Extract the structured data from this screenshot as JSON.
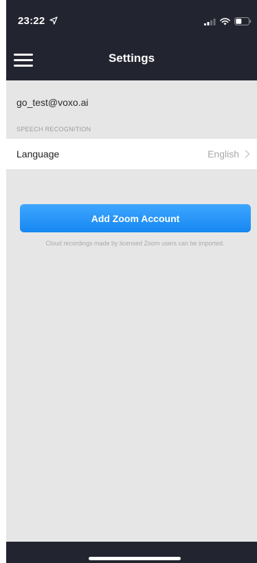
{
  "status_bar": {
    "time": "23:22",
    "icons": [
      "location-arrow-icon",
      "signal-icon",
      "wifi-icon",
      "battery-icon"
    ]
  },
  "navbar": {
    "title": "Settings",
    "menu_icon": "hamburger-menu-icon"
  },
  "account": {
    "email": "go_test@voxo.ai"
  },
  "speech_recognition": {
    "header": "SPEECH RECOGNITION",
    "language_label": "Language",
    "language_value": "English"
  },
  "zoom": {
    "button_label": "Add Zoom Account",
    "hint": "Cloud recordings made by licensed Zoom users can be imported."
  },
  "colors": {
    "bar_dark": "#22242f",
    "background": "#e6e6e6",
    "accent_blue": "#1f8ff5",
    "muted_text": "#a8a8a8"
  }
}
